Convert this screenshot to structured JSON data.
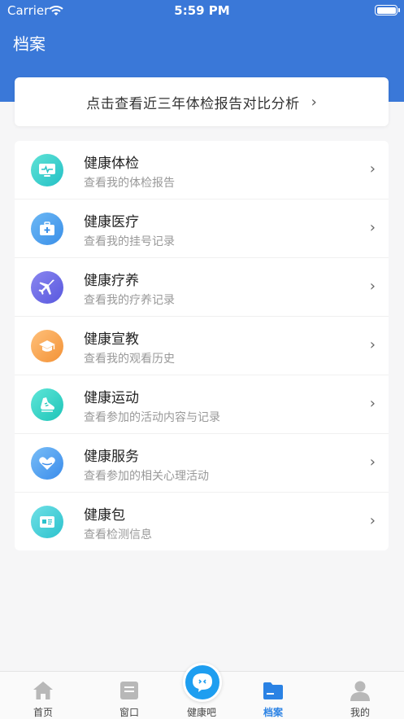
{
  "status_bar": {
    "carrier": "Carrier",
    "time": "5:59 PM"
  },
  "header": {
    "title": "档案"
  },
  "compare": {
    "label": "点击查看近三年体检报告对比分析",
    "chevron": "›"
  },
  "list": {
    "items": [
      {
        "title": "健康体检",
        "subtitle": "查看我的体检报告",
        "icon": "monitor-pulse-icon",
        "color": "#3dd3c6"
      },
      {
        "title": "健康医疗",
        "subtitle": "查看我的挂号记录",
        "icon": "medical-kit-icon",
        "color": "#4aa2ee"
      },
      {
        "title": "健康疗养",
        "subtitle": "查看我的疗养记录",
        "icon": "airplane-icon",
        "color": "#6e6ee6"
      },
      {
        "title": "健康宣教",
        "subtitle": "查看我的观看历史",
        "icon": "graduation-cap-icon",
        "color": "#f5a54a"
      },
      {
        "title": "健康运动",
        "subtitle": "查看参加的活动内容与记录",
        "icon": "running-shoe-icon",
        "color": "#2fd3c2"
      },
      {
        "title": "健康服务",
        "subtitle": "查看参加的相关心理活动",
        "icon": "heart-hands-icon",
        "color": "#4a9ef0"
      },
      {
        "title": "健康包",
        "subtitle": "查看检测信息",
        "icon": "health-card-icon",
        "color": "#3fcfd6"
      }
    ],
    "chevron": "›"
  },
  "tabbar": {
    "tabs": [
      {
        "label": "首页",
        "icon": "home-icon",
        "active": false
      },
      {
        "label": "窗口",
        "icon": "window-icon",
        "active": false
      },
      {
        "label": "健康吧",
        "icon": "chat-bubble-icon",
        "active": false
      },
      {
        "label": "档案",
        "icon": "folder-icon",
        "active": true
      },
      {
        "label": "我的",
        "icon": "user-icon",
        "active": false
      }
    ]
  },
  "colors": {
    "header": "#3a78d8",
    "active_tab": "#2a82e4",
    "center_button": "#1e9ef0"
  }
}
